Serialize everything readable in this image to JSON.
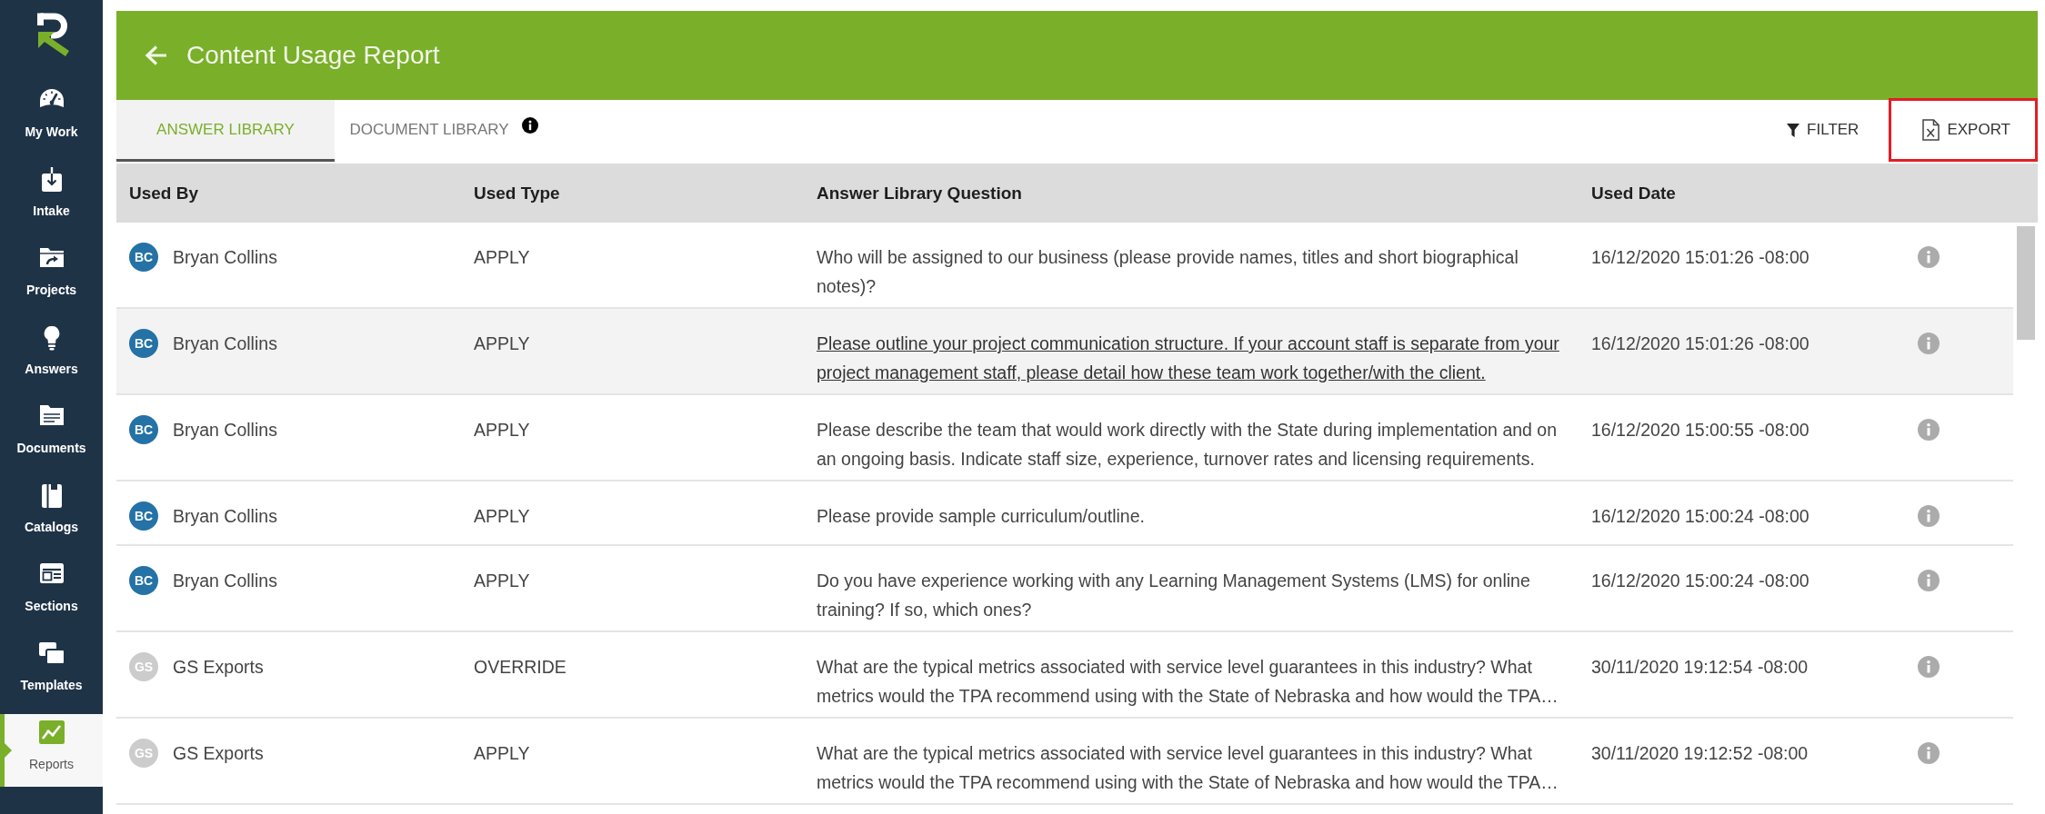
{
  "sidebar": {
    "items": [
      {
        "label": "My Work",
        "selected": false
      },
      {
        "label": "Intake",
        "selected": false
      },
      {
        "label": "Projects",
        "selected": false
      },
      {
        "label": "Answers",
        "selected": false
      },
      {
        "label": "Documents",
        "selected": false
      },
      {
        "label": "Catalogs",
        "selected": false
      },
      {
        "label": "Sections",
        "selected": false
      },
      {
        "label": "Templates",
        "selected": false
      },
      {
        "label": "Reports",
        "selected": true
      }
    ]
  },
  "header": {
    "title": "Content Usage Report"
  },
  "tabs": [
    {
      "label": "ANSWER LIBRARY",
      "selected": true,
      "info": false
    },
    {
      "label": "DOCUMENT LIBRARY",
      "selected": false,
      "info": true
    }
  ],
  "actions": [
    {
      "kind": "filter",
      "label": "FILTER",
      "highlighted": false
    },
    {
      "kind": "export",
      "label": "EXPORT",
      "highlighted": true
    }
  ],
  "table": {
    "columns": [
      "Used By",
      "Used Type",
      "Answer Library Question",
      "Used Date"
    ],
    "rows": [
      {
        "initials": "BC",
        "color": "#2472a6",
        "used_by": "Bryan Collins",
        "used_type": "APPLY",
        "question": "Who will be assigned to our business (please provide names, titles and short biographical notes)?",
        "used_date": "16/12/2020 15:01:26 -08:00",
        "hovered": false
      },
      {
        "initials": "BC",
        "color": "#2472a6",
        "used_by": "Bryan Collins",
        "used_type": "APPLY",
        "question": "Please outline your project communication structure. If your account staff is separate from your project management staff, please detail how these team work together/with the client.",
        "used_date": "16/12/2020 15:01:26 -08:00",
        "hovered": true
      },
      {
        "initials": "BC",
        "color": "#2472a6",
        "used_by": "Bryan Collins",
        "used_type": "APPLY",
        "question": "Please describe the team that would work directly with the State during implementation and on an ongoing basis. Indicate staff size, experience, turnover rates and licensing requirements.",
        "used_date": "16/12/2020 15:00:55 -08:00",
        "hovered": false
      },
      {
        "initials": "BC",
        "color": "#2472a6",
        "used_by": "Bryan Collins",
        "used_type": "APPLY",
        "question": "Please provide sample curriculum/outline.",
        "used_date": "16/12/2020 15:00:24 -08:00",
        "hovered": false
      },
      {
        "initials": "BC",
        "color": "#2472a6",
        "used_by": "Bryan Collins",
        "used_type": "APPLY",
        "question": "Do you have experience working with any Learning Management Systems (LMS) for online training? If so, which ones?",
        "used_date": "16/12/2020 15:00:24 -08:00",
        "hovered": false
      },
      {
        "initials": "GS",
        "color": "#cccccc",
        "used_by": "GS Exports",
        "used_type": "OVERRIDE",
        "question": "What are the typical metrics associated with service level guarantees in this industry? What metrics would the TPA recommend using with the State of Nebraska and how would the TPA…",
        "used_date": "30/11/2020 19:12:54 -08:00",
        "hovered": false
      },
      {
        "initials": "GS",
        "color": "#cccccc",
        "used_by": "GS Exports",
        "used_type": "APPLY",
        "question": "What are the typical metrics associated with service level guarantees in this industry? What metrics would the TPA recommend using with the State of Nebraska and how would the TPA…",
        "used_date": "30/11/2020 19:12:52 -08:00",
        "hovered": false
      }
    ]
  }
}
